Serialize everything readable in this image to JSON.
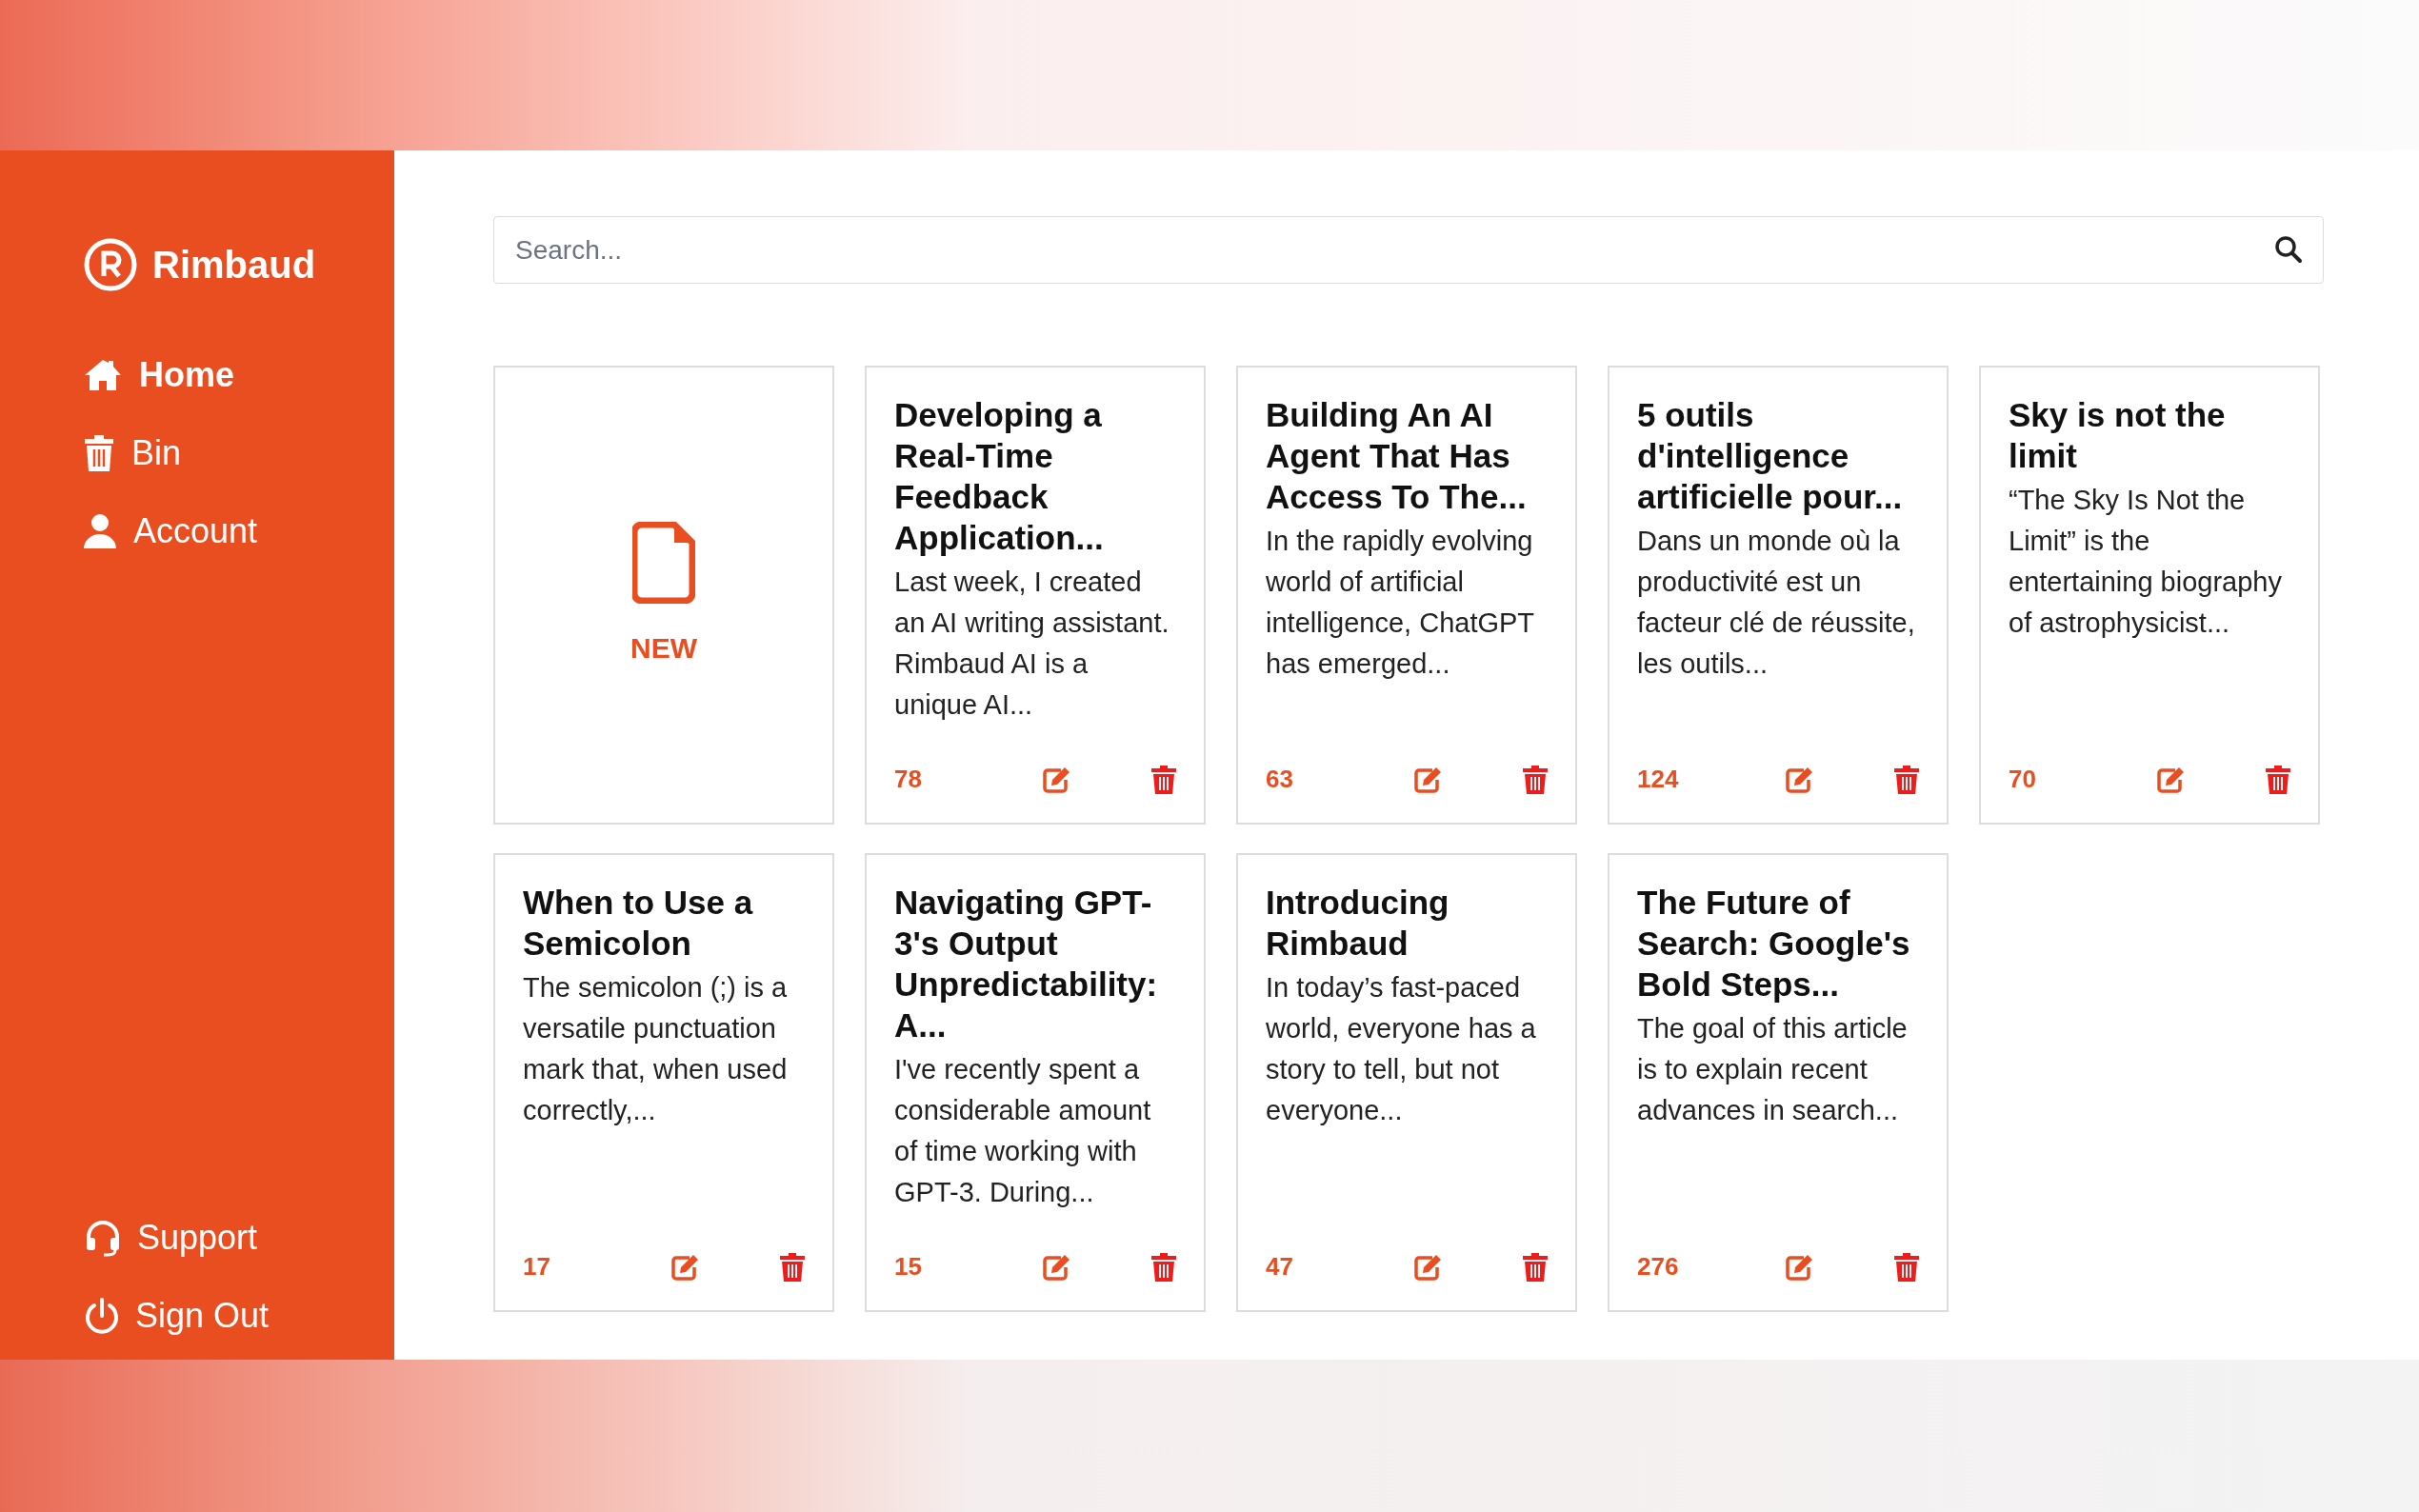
{
  "sidebar": {
    "brand": "Rimbaud",
    "items": [
      {
        "label": "Home",
        "selected": true
      },
      {
        "label": "Bin",
        "selected": false
      },
      {
        "label": "Account",
        "selected": false
      }
    ],
    "footer_items": [
      {
        "label": "Support"
      },
      {
        "label": "Sign Out"
      }
    ]
  },
  "search": {
    "placeholder": "Search..."
  },
  "cards": [
    {
      "kind": "new",
      "label": "NEW"
    },
    {
      "kind": "doc",
      "title": "Developing a Real-Time Feedback Application...",
      "excerpt": "Last week, I created an AI writing assistant. Rimbaud AI is a unique AI...",
      "count": "78"
    },
    {
      "kind": "doc",
      "title": "Building An AI Agent That Has Access To The...",
      "excerpt": "In the rapidly evolving world of artificial intelligence, ChatGPT has emerged...",
      "count": "63"
    },
    {
      "kind": "doc",
      "title": "5 outils d'intelligence artificielle pour...",
      "excerpt": "Dans un monde où la productivité est un facteur clé de réussite, les outils...",
      "count": "124"
    },
    {
      "kind": "doc",
      "title": "Sky is not the limit",
      "excerpt": "“The Sky Is Not the Limit” is the entertaining biography of astrophysicist...",
      "count": "70"
    },
    {
      "kind": "doc",
      "title": "When to Use a Semicolon",
      "excerpt": "The semicolon (;) is a versatile punctuation mark that, when used correctly,...",
      "count": "17"
    },
    {
      "kind": "doc",
      "title": "Navigating GPT-3's Output Unpredictability: A...",
      "excerpt": "I've recently spent a considerable amount of time working with GPT-3. During...",
      "count": "15"
    },
    {
      "kind": "doc",
      "title": "Introducing Rimbaud",
      "excerpt": "In today’s fast-paced world, everyone has a story to tell, but not everyone...",
      "count": "47"
    },
    {
      "kind": "doc",
      "title": "The Future of Search: Google's Bold Steps...",
      "excerpt": "The goal of this article is to explain recent advances in search...",
      "count": "276"
    }
  ]
}
